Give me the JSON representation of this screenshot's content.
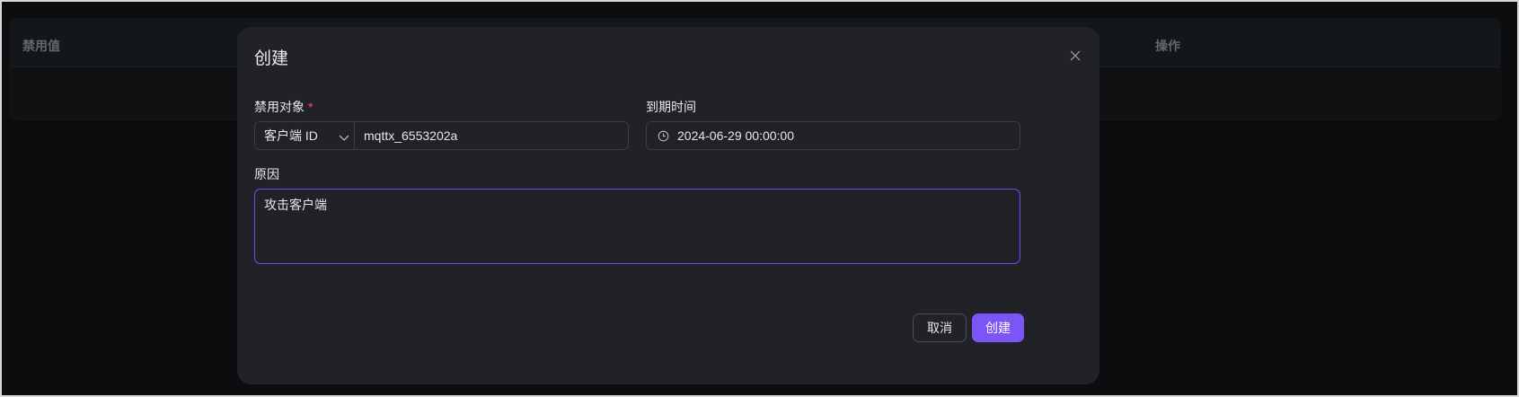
{
  "background_table": {
    "columns": [
      "禁用值",
      "操作"
    ]
  },
  "modal": {
    "title": "创建",
    "close_icon": "close-icon",
    "ban_target": {
      "label": "禁用对象",
      "required_mark": "*",
      "type_value": "客户端 ID",
      "value": "mqttx_6553202a"
    },
    "expire": {
      "label": "到期时间",
      "value": "2024-06-29 00:00:00",
      "icon": "clock-icon"
    },
    "reason": {
      "label": "原因",
      "value": "攻击客户端"
    },
    "buttons": {
      "cancel": "取消",
      "create": "创建"
    }
  },
  "colors": {
    "accent": "#7b55f6",
    "required": "#ff4d4f",
    "modal_bg": "#202227",
    "page_bg": "#111214"
  }
}
